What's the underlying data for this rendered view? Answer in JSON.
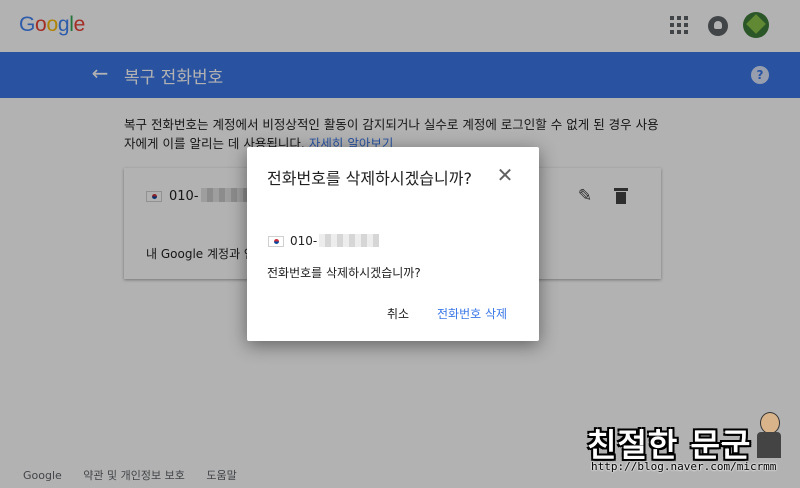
{
  "app": {
    "logo_letters": [
      {
        "char": "G",
        "color": "#4285f4"
      },
      {
        "char": "o",
        "color": "#ea4335"
      },
      {
        "char": "o",
        "color": "#fbbc05"
      },
      {
        "char": "g",
        "color": "#4285f4"
      },
      {
        "char": "l",
        "color": "#34a853"
      },
      {
        "char": "e",
        "color": "#ea4335"
      }
    ],
    "logo_text": "Google",
    "icons": [
      "apps-icon",
      "notifications-icon",
      "account-avatar"
    ]
  },
  "header": {
    "back_icon": "arrow-left-icon",
    "title": "복구 전화번호",
    "help_icon": "?"
  },
  "content": {
    "description_text": "복구 전화번호는 계정에서 비정상적인 활동이 감지되거나 실수로 계정에 로그인할 수 없게 된 경우 사용자에게 이를 알리는 데 사용됩니다. ",
    "learn_more_link": "자세히 알아보기",
    "phone_card": {
      "flag": "kr-flag",
      "number": "010-",
      "note": "내 Google 계정과 연"
    }
  },
  "dialog": {
    "title": "전화번호를 삭제하시겠습니까?",
    "phone_number": "010-",
    "message": "전화번호를 삭제하시겠습니까?",
    "cancel_label": "취소",
    "confirm_label": "전화번호 삭제",
    "close_icon": "✕"
  },
  "footer": {
    "links": [
      "Google",
      "약관 및 개인정보 보호",
      "도움말"
    ]
  },
  "watermark": {
    "title": "친절한 문군",
    "url": "http://blog.naver.com/micrmm"
  },
  "colors": {
    "header_blue": "#3b78e7",
    "link_blue": "#3b78e7",
    "overlay": "rgba(0,0,0,0.30)"
  }
}
